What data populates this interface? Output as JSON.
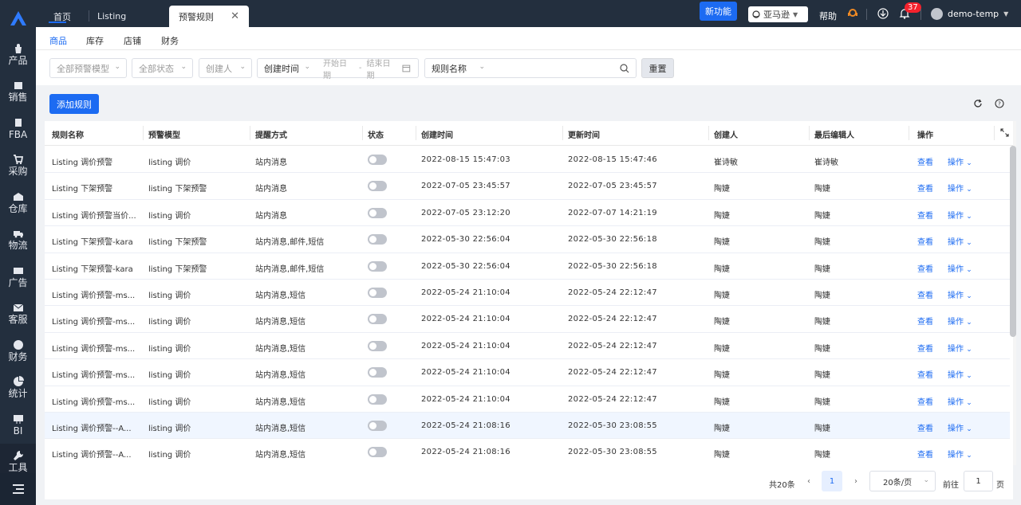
{
  "sidebar": {
    "items": [
      {
        "label": "产品",
        "icon": "bag-icon"
      },
      {
        "label": "销售",
        "icon": "sell-icon"
      },
      {
        "label": "FBA",
        "icon": "fba-icon"
      },
      {
        "label": "采购",
        "icon": "cart-icon"
      },
      {
        "label": "仓库",
        "icon": "warehouse-icon"
      },
      {
        "label": "物流",
        "icon": "truck-icon"
      },
      {
        "label": "广告",
        "icon": "ad-icon"
      },
      {
        "label": "客服",
        "icon": "mail-icon"
      },
      {
        "label": "财务",
        "icon": "yen-icon"
      },
      {
        "label": "统计",
        "icon": "pie-icon"
      },
      {
        "label": "BI",
        "icon": "bi-icon"
      },
      {
        "label": "工具",
        "icon": "wrench-icon"
      }
    ]
  },
  "topbar": {
    "tabs": [
      "首页",
      "Listing",
      "预警规则"
    ],
    "new_feature": "新功能",
    "platform": "亚马逊",
    "help": "帮助",
    "notification_count": "37",
    "username": "demo-temp"
  },
  "subnav": {
    "tabs": [
      "商品",
      "库存",
      "店铺",
      "财务"
    ]
  },
  "filters": {
    "model": "全部预警模型",
    "status": "全部状态",
    "creator": "创建人",
    "time_type": "创建时间",
    "date_start": "开始日期",
    "date_sep": "-",
    "date_end": "结束日期",
    "field": "规则名称",
    "reset": "重置"
  },
  "actions": {
    "add": "添加规则"
  },
  "table": {
    "headers": [
      "规则名称",
      "预警模型",
      "提醒方式",
      "状态",
      "创建时间",
      "更新时间",
      "创建人",
      "最后编辑人",
      "操作"
    ],
    "view": "查看",
    "op": "操作",
    "rows": [
      [
        "Listing 调价预警",
        "listing 调价",
        "站内消息",
        "2022-08-15 15:47:03",
        "2022-08-15 15:47:46",
        "崔诗敏",
        "崔诗敏"
      ],
      [
        "Listing 下架预警",
        "listing 下架预警",
        "站内消息",
        "2022-07-05 23:45:57",
        "2022-07-05 23:45:57",
        "陶婕",
        "陶婕"
      ],
      [
        "Listing 调价预警当价...",
        "listing 调价",
        "站内消息",
        "2022-07-05 23:12:20",
        "2022-07-07 14:21:19",
        "陶婕",
        "陶婕"
      ],
      [
        "Listing 下架预警-kara",
        "listing 下架预警",
        "站内消息,邮件,短信",
        "2022-05-30 22:56:04",
        "2022-05-30 22:56:18",
        "陶婕",
        "陶婕"
      ],
      [
        "Listing 下架预警-kara",
        "listing 下架预警",
        "站内消息,邮件,短信",
        "2022-05-30 22:56:04",
        "2022-05-30 22:56:18",
        "陶婕",
        "陶婕"
      ],
      [
        "Listing 调价预警-ms...",
        "listing 调价",
        "站内消息,短信",
        "2022-05-24 21:10:04",
        "2022-05-24 22:12:47",
        "陶婕",
        "陶婕"
      ],
      [
        "Listing 调价预警-ms...",
        "listing 调价",
        "站内消息,短信",
        "2022-05-24 21:10:04",
        "2022-05-24 22:12:47",
        "陶婕",
        "陶婕"
      ],
      [
        "Listing 调价预警-ms...",
        "listing 调价",
        "站内消息,短信",
        "2022-05-24 21:10:04",
        "2022-05-24 22:12:47",
        "陶婕",
        "陶婕"
      ],
      [
        "Listing 调价预警-ms...",
        "listing 调价",
        "站内消息,短信",
        "2022-05-24 21:10:04",
        "2022-05-24 22:12:47",
        "陶婕",
        "陶婕"
      ],
      [
        "Listing 调价预警-ms...",
        "listing 调价",
        "站内消息,短信",
        "2022-05-24 21:10:04",
        "2022-05-24 22:12:47",
        "陶婕",
        "陶婕"
      ],
      [
        "Listing 调价预警--A...",
        "listing 调价",
        "站内消息,短信",
        "2022-05-24 21:08:16",
        "2022-05-30 23:08:55",
        "陶婕",
        "陶婕"
      ],
      [
        "Listing 调价预警--A...",
        "listing 调价",
        "站内消息,短信",
        "2022-05-24 21:08:16",
        "2022-05-30 23:08:55",
        "陶婕",
        "陶婕"
      ]
    ]
  },
  "pagination": {
    "total": "共20条",
    "current": "1",
    "page_size": "20条/页",
    "goto_prefix": "前往",
    "goto_value": "1",
    "goto_suffix": "页"
  }
}
